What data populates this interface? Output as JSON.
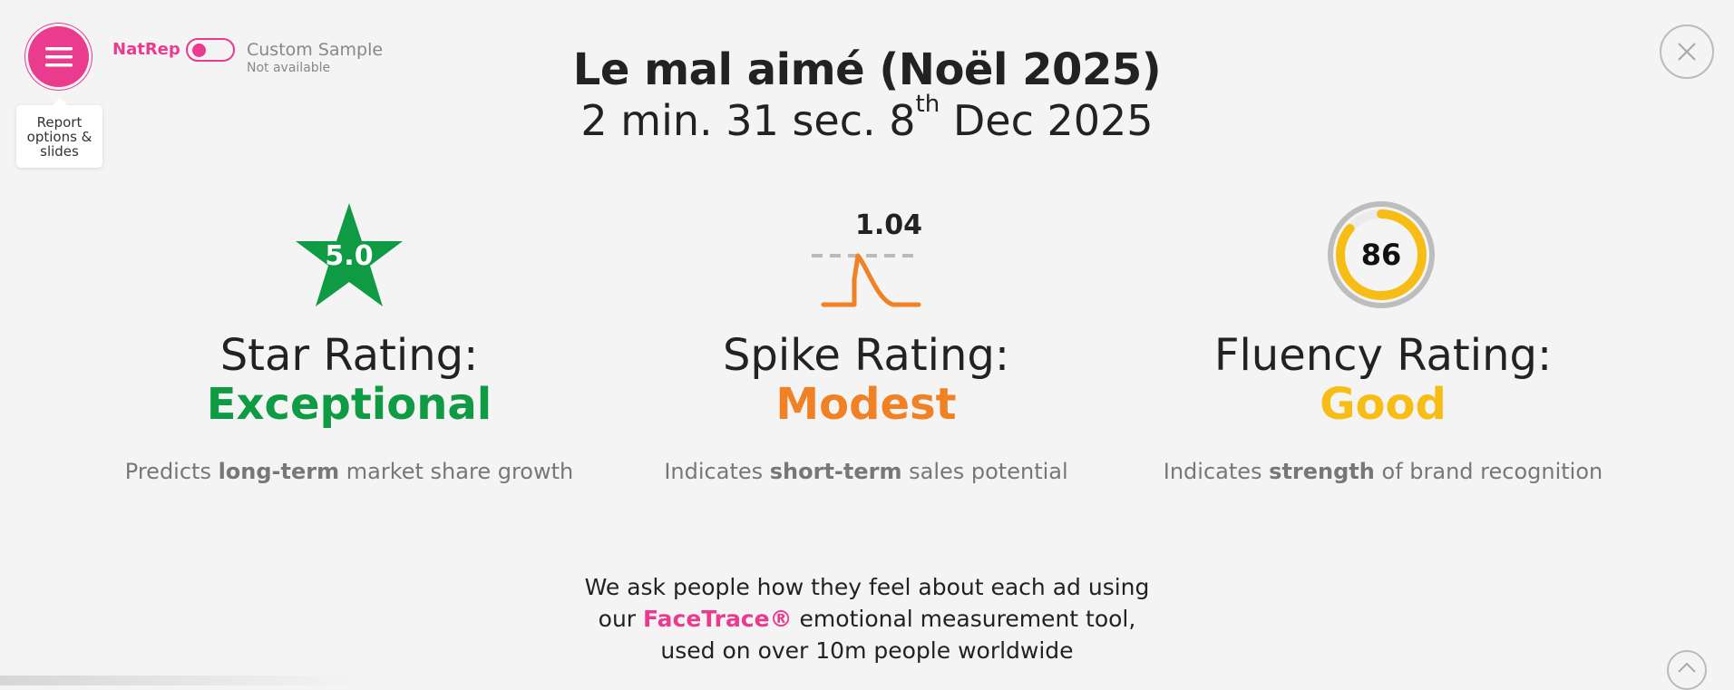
{
  "header": {
    "menu_icon": "hamburger-menu-icon",
    "tooltip_text": "Report options & slides",
    "natrep_label": "NatRep",
    "toggle_state": "off",
    "custom_sample_label": "Custom Sample",
    "custom_sample_status": "Not available",
    "close_icon": "close-icon"
  },
  "report": {
    "title": "Le mal aimé (Noël 2025)",
    "duration": "2 min. 31 sec.",
    "date_day": "8",
    "date_suffix": "th",
    "date_rest": "Dec 2025"
  },
  "metrics": [
    {
      "icon": "star-icon",
      "icon_value": "5.0",
      "label": "Star Rating:",
      "rating": "Exceptional",
      "color": "#0f9a44",
      "desc_pre": "Predicts ",
      "desc_bold": "long-term",
      "desc_post": " market share growth"
    },
    {
      "icon": "spike-icon",
      "icon_value": "1.04",
      "label": "Spike Rating:",
      "rating": "Modest",
      "color": "#f08125",
      "desc_pre": "Indicates ",
      "desc_bold": "short-term",
      "desc_post": " sales potential"
    },
    {
      "icon": "fluency-ring-icon",
      "icon_value": "86",
      "ring_fill_fraction": 0.86,
      "label": "Fluency Rating:",
      "rating": "Good",
      "color": "#f7bd14",
      "desc_pre": "Indicates ",
      "desc_bold": "strength",
      "desc_post": " of brand recognition"
    }
  ],
  "footer": {
    "line1": "We ask people how they feel about each ad using",
    "line2_pre": "our ",
    "line2_brand": "FaceTrace®",
    "line2_post": " emotional measurement tool,",
    "line3": "used on over 10m people worldwide"
  },
  "colors": {
    "brand_pink": "#ea3b8e",
    "background": "#f4f4f4"
  }
}
